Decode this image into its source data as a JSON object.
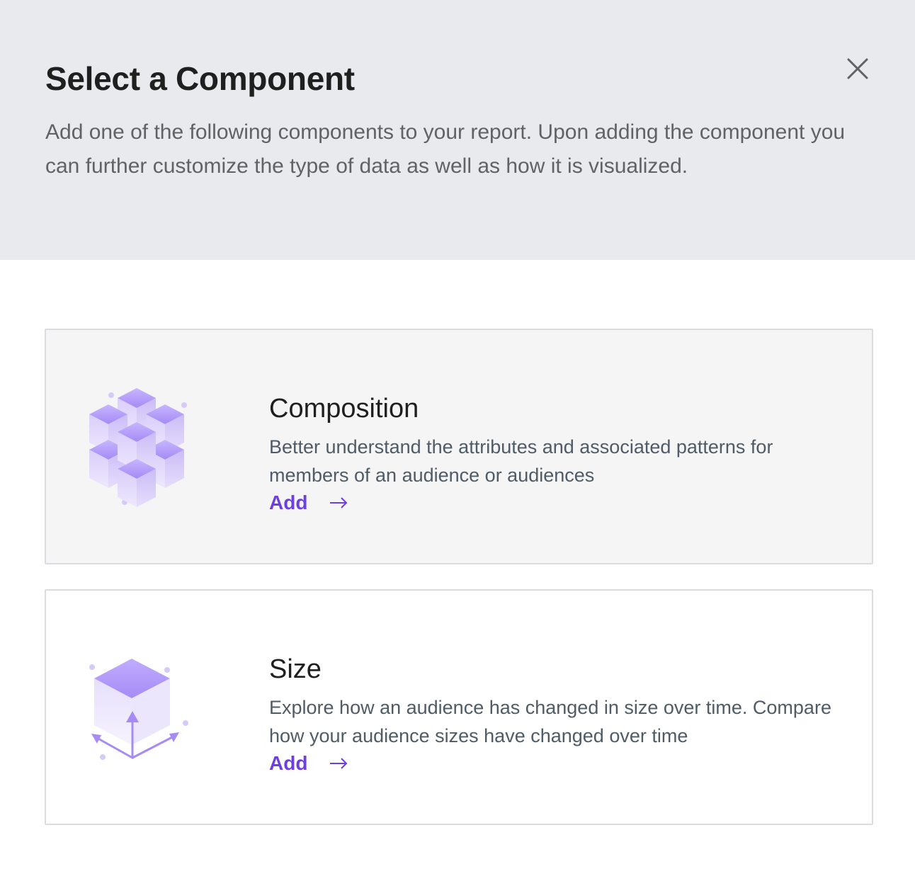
{
  "dialog": {
    "title": "Select a Component",
    "description": "Add one of the following components to your report. Upon adding the component you can further customize the type of data as well as how it is visualized."
  },
  "components": [
    {
      "title": "Composition",
      "description": "Better understand the attributes and associated patterns for members of an audience or audiences",
      "action_label": "Add",
      "icon": "cubes-cluster-icon"
    },
    {
      "title": "Size",
      "description": "Explore how an audience has changed in size over time. Compare how your audience sizes have changed over time",
      "action_label": "Add",
      "icon": "cube-growth-icon"
    }
  ],
  "colors": {
    "accent": "#6d3fe0",
    "header_bg": "#e8eaed",
    "selected_card_bg": "#f5f5f5"
  }
}
